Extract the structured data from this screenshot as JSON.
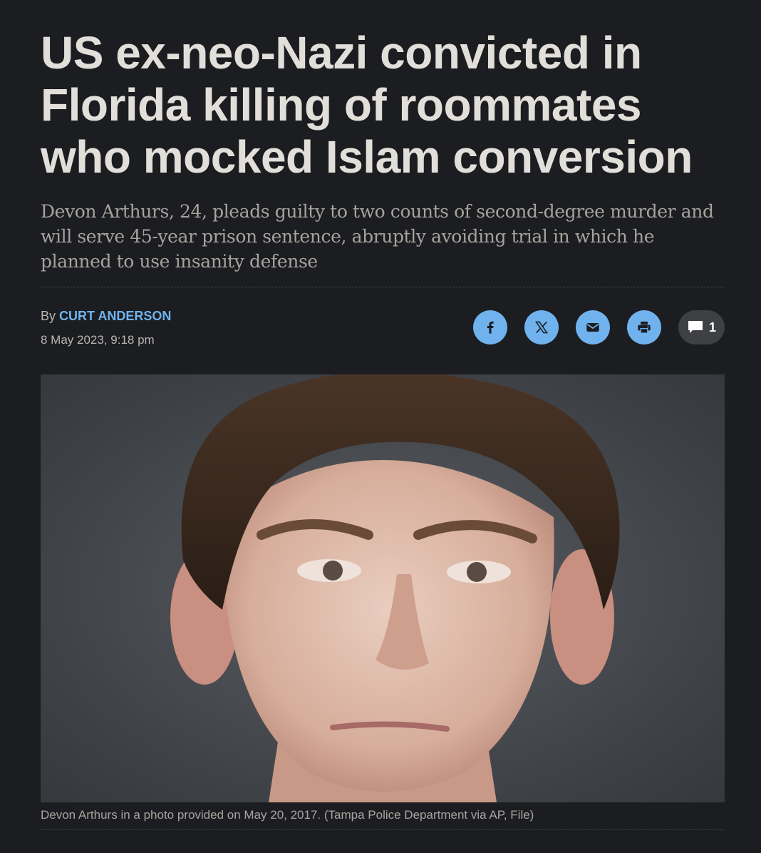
{
  "article": {
    "headline": "US ex-neo-Nazi convicted in Florida killing of roommates who mocked Islam conversion",
    "deck": "Devon Arthurs, 24, pleads guilty to two counts of second-degree murder and will serve 45-year prison sentence, abruptly avoiding trial in which he planned to use insanity defense",
    "byline_prefix": "By",
    "author": "CURT ANDERSON",
    "date": "8 May 2023, 9:18 pm"
  },
  "share": {
    "buttons": [
      {
        "name": "facebook",
        "icon": "facebook-icon"
      },
      {
        "name": "x",
        "icon": "x-icon"
      },
      {
        "name": "email",
        "icon": "envelope-icon"
      },
      {
        "name": "print",
        "icon": "printer-icon"
      }
    ],
    "comment_count": "1"
  },
  "photo": {
    "caption": "Devon Arthurs in a photo provided on May 20, 2017. (Tampa Police Department via AP, File)"
  },
  "colors": {
    "background": "#1c1d20",
    "accent": "#6fb2ee",
    "headline": "#e2dfda"
  }
}
